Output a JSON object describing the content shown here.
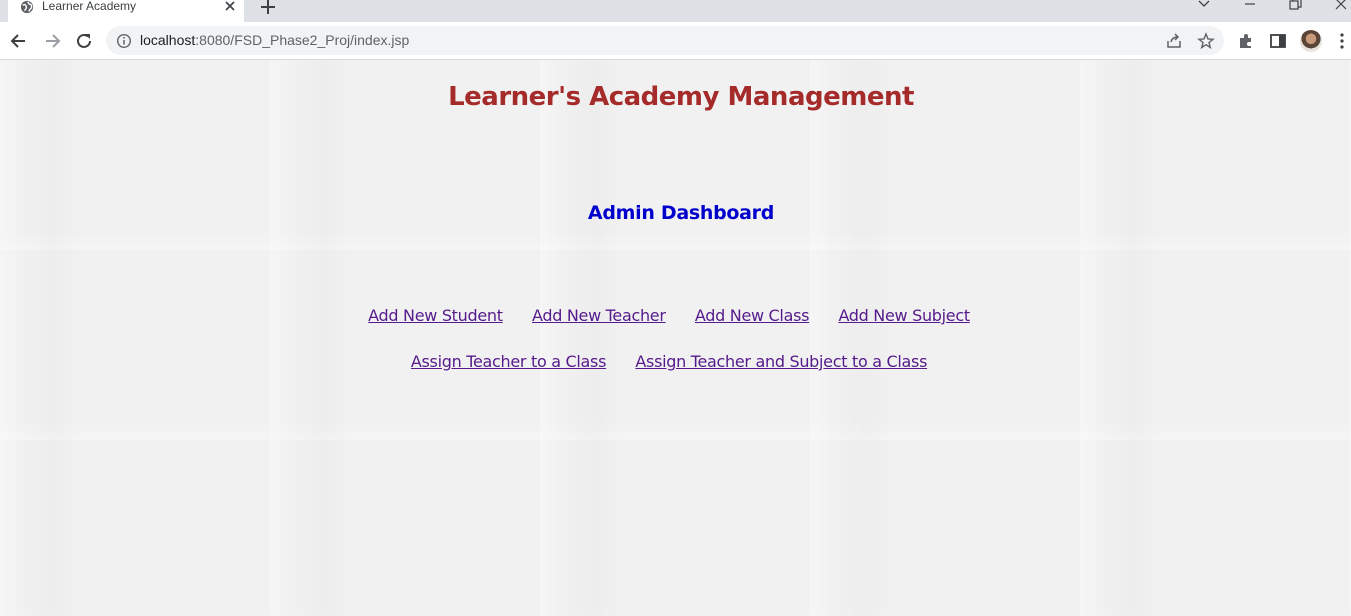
{
  "browser": {
    "tab_title": "Learner Academy",
    "url_host": "localhost",
    "url_path": ":8080/FSD_Phase2_Proj/index.jsp"
  },
  "page": {
    "heading": "Learner's Academy Management",
    "subheading": "Admin Dashboard",
    "links_row1": [
      {
        "label": "Add New Student"
      },
      {
        "label": "Add New Teacher"
      },
      {
        "label": "Add New Class"
      },
      {
        "label": "Add New Subject"
      }
    ],
    "links_row2": [
      {
        "label": "Assign Teacher to a Class"
      },
      {
        "label": "Assign Teacher and Subject to a Class"
      }
    ]
  },
  "colors": {
    "heading": "#a52a2a",
    "subheading": "#0000cd",
    "link": "#551a8b",
    "page_background": "#f1f1f1"
  },
  "icons": [
    "globe-icon",
    "close-icon",
    "plus-icon",
    "chevron-down-icon",
    "minimize-icon",
    "restore-icon",
    "back-arrow-icon",
    "forward-arrow-icon",
    "reload-icon",
    "info-icon",
    "share-icon",
    "star-icon",
    "puzzle-icon",
    "side-panel-icon",
    "kebab-menu-icon"
  ]
}
